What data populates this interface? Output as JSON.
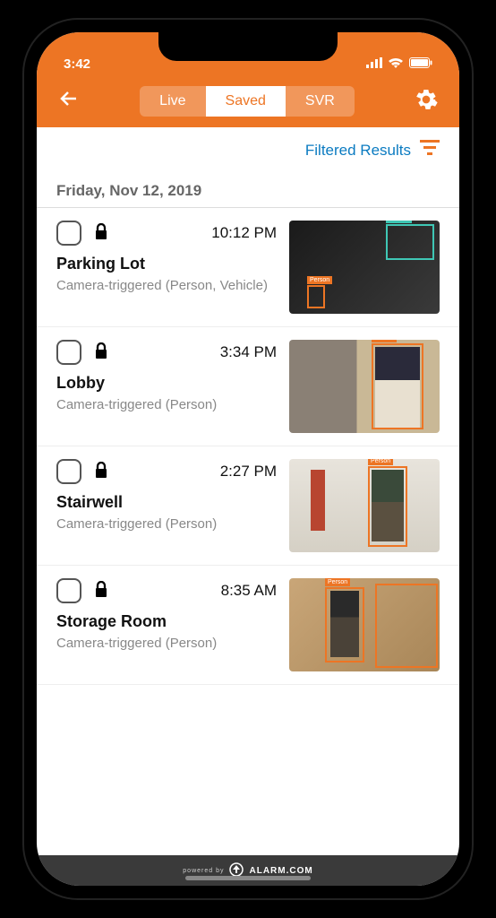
{
  "status": {
    "time": "3:42"
  },
  "tabs": {
    "live": "Live",
    "saved": "Saved",
    "svr": "SVR",
    "active": "saved"
  },
  "filter": {
    "label": "Filtered Results"
  },
  "date_header": "Friday, Nov 12, 2019",
  "clips": [
    {
      "time": "10:12 PM",
      "title": "Parking Lot",
      "subtitle": "Camera-triggered (Person, Vehicle)",
      "thumb_style": "parking"
    },
    {
      "time": "3:34 PM",
      "title": "Lobby",
      "subtitle": "Camera-triggered (Person)",
      "thumb_style": "lobby"
    },
    {
      "time": "2:27 PM",
      "title": "Stairwell",
      "subtitle": "Camera-triggered (Person)",
      "thumb_style": "stairwell"
    },
    {
      "time": "8:35 AM",
      "title": "Storage Room",
      "subtitle": "Camera-triggered (Person)",
      "thumb_style": "storage"
    }
  ],
  "footer": {
    "powered_by": "powered by",
    "brand": "ALARM.COM"
  },
  "colors": {
    "accent": "#ed7524",
    "link": "#0b7bc1",
    "detect_person": "#ed7524",
    "detect_vehicle": "#3fc7b5"
  }
}
